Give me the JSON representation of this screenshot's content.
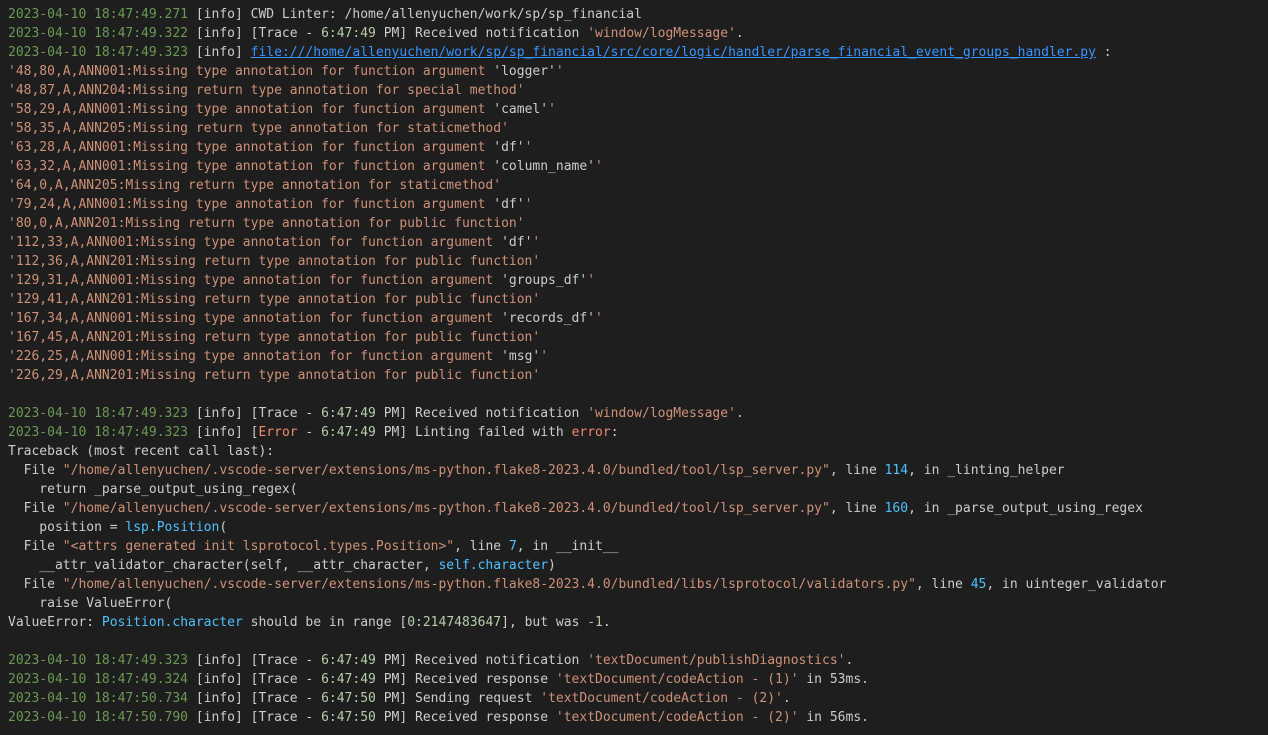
{
  "colors": {
    "background": "#1e1e1e",
    "text": "#cccccc",
    "timestamp": "#6a9955",
    "string": "#ce9178",
    "number": "#b5cea8",
    "keyword": "#569cd6",
    "link": "#3794ff",
    "error": "#f48771"
  },
  "log": [
    [
      [
        "ts",
        "2023-04-10 18:47:49.271"
      ],
      [
        "tx",
        " [info] CWD Linter: /home/allenyuchen/work/sp/sp_financial"
      ]
    ],
    [
      [
        "ts",
        "2023-04-10 18:47:49.322"
      ],
      [
        "tx",
        " [info] [Trace - "
      ],
      [
        "num",
        "6:47:49"
      ],
      [
        "tx",
        " PM] Received notification "
      ],
      [
        "str",
        "'window/logMessage'"
      ],
      [
        "tx",
        "."
      ]
    ],
    [
      [
        "ts",
        "2023-04-10 18:47:49.323"
      ],
      [
        "tx",
        " [info] "
      ],
      [
        "link",
        "file:///home/allenyuchen/work/sp/sp_financial/src/core/logic/handler/parse_financial_event_groups_handler.py"
      ],
      [
        "tx",
        " :"
      ]
    ],
    [
      [
        "str",
        "'48,80,A,ANN001:Missing type annotation for function argument "
      ],
      [
        "tx",
        "'logger'"
      ],
      [
        "str",
        "'"
      ]
    ],
    [
      [
        "str",
        "'48,87,A,ANN204:Missing return type annotation for special method'"
      ]
    ],
    [
      [
        "str",
        "'58,29,A,ANN001:Missing type annotation for function argument "
      ],
      [
        "tx",
        "'camel'"
      ],
      [
        "str",
        "'"
      ]
    ],
    [
      [
        "str",
        "'58,35,A,ANN205:Missing return type annotation for staticmethod'"
      ]
    ],
    [
      [
        "str",
        "'63,28,A,ANN001:Missing type annotation for function argument "
      ],
      [
        "tx",
        "'df'"
      ],
      [
        "str",
        "'"
      ]
    ],
    [
      [
        "str",
        "'63,32,A,ANN001:Missing type annotation for function argument "
      ],
      [
        "tx",
        "'column_name'"
      ],
      [
        "str",
        "'"
      ]
    ],
    [
      [
        "str",
        "'64,0,A,ANN205:Missing return type annotation for staticmethod'"
      ]
    ],
    [
      [
        "str",
        "'79,24,A,ANN001:Missing type annotation for function argument "
      ],
      [
        "tx",
        "'df'"
      ],
      [
        "str",
        "'"
      ]
    ],
    [
      [
        "str",
        "'80,0,A,ANN201:Missing return type annotation for public function'"
      ]
    ],
    [
      [
        "str",
        "'112,33,A,ANN001:Missing type annotation for function argument "
      ],
      [
        "tx",
        "'df'"
      ],
      [
        "str",
        "'"
      ]
    ],
    [
      [
        "str",
        "'112,36,A,ANN201:Missing return type annotation for public function'"
      ]
    ],
    [
      [
        "str",
        "'129,31,A,ANN001:Missing type annotation for function argument "
      ],
      [
        "tx",
        "'groups_df'"
      ],
      [
        "str",
        "'"
      ]
    ],
    [
      [
        "str",
        "'129,41,A,ANN201:Missing return type annotation for public function'"
      ]
    ],
    [
      [
        "str",
        "'167,34,A,ANN001:Missing type annotation for function argument "
      ],
      [
        "tx",
        "'records_df'"
      ],
      [
        "str",
        "'"
      ]
    ],
    [
      [
        "str",
        "'167,45,A,ANN201:Missing return type annotation for public function'"
      ]
    ],
    [
      [
        "str",
        "'226,25,A,ANN001:Missing type annotation for function argument "
      ],
      [
        "tx",
        "'msg'"
      ],
      [
        "str",
        "'"
      ]
    ],
    [
      [
        "str",
        "'226,29,A,ANN201:Missing return type annotation for public function'"
      ]
    ],
    [],
    [
      [
        "ts",
        "2023-04-10 18:47:49.323"
      ],
      [
        "tx",
        " [info] [Trace - "
      ],
      [
        "num",
        "6:47:49"
      ],
      [
        "tx",
        " PM] Received notification "
      ],
      [
        "str",
        "'window/logMessage'"
      ],
      [
        "tx",
        "."
      ]
    ],
    [
      [
        "ts",
        "2023-04-10 18:47:49.323"
      ],
      [
        "tx",
        " [info] ["
      ],
      [
        "err",
        "Error"
      ],
      [
        "tx",
        " - "
      ],
      [
        "num",
        "6:47:49"
      ],
      [
        "tx",
        " PM] Linting failed with "
      ],
      [
        "err",
        "error"
      ],
      [
        "tx",
        ":"
      ]
    ],
    [
      [
        "tx",
        "Traceback (most recent call last):"
      ]
    ],
    [
      [
        "tx",
        "  File "
      ],
      [
        "str",
        "\"/home/allenyuchen/.vscode-server/extensions/ms-python.flake8-2023.4.0/bundled/tool/lsp_server.py\""
      ],
      [
        "tx",
        ", line "
      ],
      [
        "blue",
        "114"
      ],
      [
        "tx",
        ", in _linting_helper"
      ]
    ],
    [
      [
        "tx",
        "    return _parse_output_using_regex("
      ]
    ],
    [
      [
        "tx",
        "  File "
      ],
      [
        "str",
        "\"/home/allenyuchen/.vscode-server/extensions/ms-python.flake8-2023.4.0/bundled/tool/lsp_server.py\""
      ],
      [
        "tx",
        ", line "
      ],
      [
        "blue",
        "160"
      ],
      [
        "tx",
        ", in _parse_output_using_regex"
      ]
    ],
    [
      [
        "tx",
        "    position = "
      ],
      [
        "blue",
        "lsp.Position"
      ],
      [
        "tx",
        "("
      ]
    ],
    [
      [
        "tx",
        "  File "
      ],
      [
        "str",
        "\"<attrs generated init lsprotocol.types.Position>\""
      ],
      [
        "tx",
        ", line "
      ],
      [
        "blue",
        "7"
      ],
      [
        "tx",
        ", in __init__"
      ]
    ],
    [
      [
        "tx",
        "    __attr_validator_character(self, __attr_character, "
      ],
      [
        "blue",
        "self.character"
      ],
      [
        "tx",
        ")"
      ]
    ],
    [
      [
        "tx",
        "  File "
      ],
      [
        "str",
        "\"/home/allenyuchen/.vscode-server/extensions/ms-python.flake8-2023.4.0/bundled/libs/lsprotocol/validators.py\""
      ],
      [
        "tx",
        ", line "
      ],
      [
        "blue",
        "45"
      ],
      [
        "tx",
        ", in uinteger_validator"
      ]
    ],
    [
      [
        "tx",
        "    raise ValueError("
      ]
    ],
    [
      [
        "tx",
        "ValueError: "
      ],
      [
        "blue",
        "Position.character"
      ],
      [
        "tx",
        " should be in range ["
      ],
      [
        "num",
        "0"
      ],
      [
        "tx",
        ":"
      ],
      [
        "num",
        "2147483647"
      ],
      [
        "tx",
        "], but was "
      ],
      [
        "num",
        "-1"
      ],
      [
        "tx",
        "."
      ]
    ],
    [],
    [
      [
        "ts",
        "2023-04-10 18:47:49.323"
      ],
      [
        "tx",
        " [info] [Trace - "
      ],
      [
        "num",
        "6:47:49"
      ],
      [
        "tx",
        " PM] Received notification "
      ],
      [
        "str",
        "'textDocument/publishDiagnostics'"
      ],
      [
        "tx",
        "."
      ]
    ],
    [
      [
        "ts",
        "2023-04-10 18:47:49.324"
      ],
      [
        "tx",
        " [info] [Trace - "
      ],
      [
        "num",
        "6:47:49"
      ],
      [
        "tx",
        " PM] Received response "
      ],
      [
        "str",
        "'textDocument/codeAction - (1)'"
      ],
      [
        "tx",
        " in 53ms."
      ]
    ],
    [
      [
        "ts",
        "2023-04-10 18:47:50.734"
      ],
      [
        "tx",
        " [info] [Trace - "
      ],
      [
        "num",
        "6:47:50"
      ],
      [
        "tx",
        " PM] Sending request "
      ],
      [
        "str",
        "'textDocument/codeAction - (2)'"
      ],
      [
        "tx",
        "."
      ]
    ],
    [
      [
        "ts",
        "2023-04-10 18:47:50.790"
      ],
      [
        "tx",
        " [info] [Trace - "
      ],
      [
        "num",
        "6:47:50"
      ],
      [
        "tx",
        " PM] Received response "
      ],
      [
        "str",
        "'textDocument/codeAction - (2)'"
      ],
      [
        "tx",
        " in 56ms."
      ]
    ]
  ]
}
